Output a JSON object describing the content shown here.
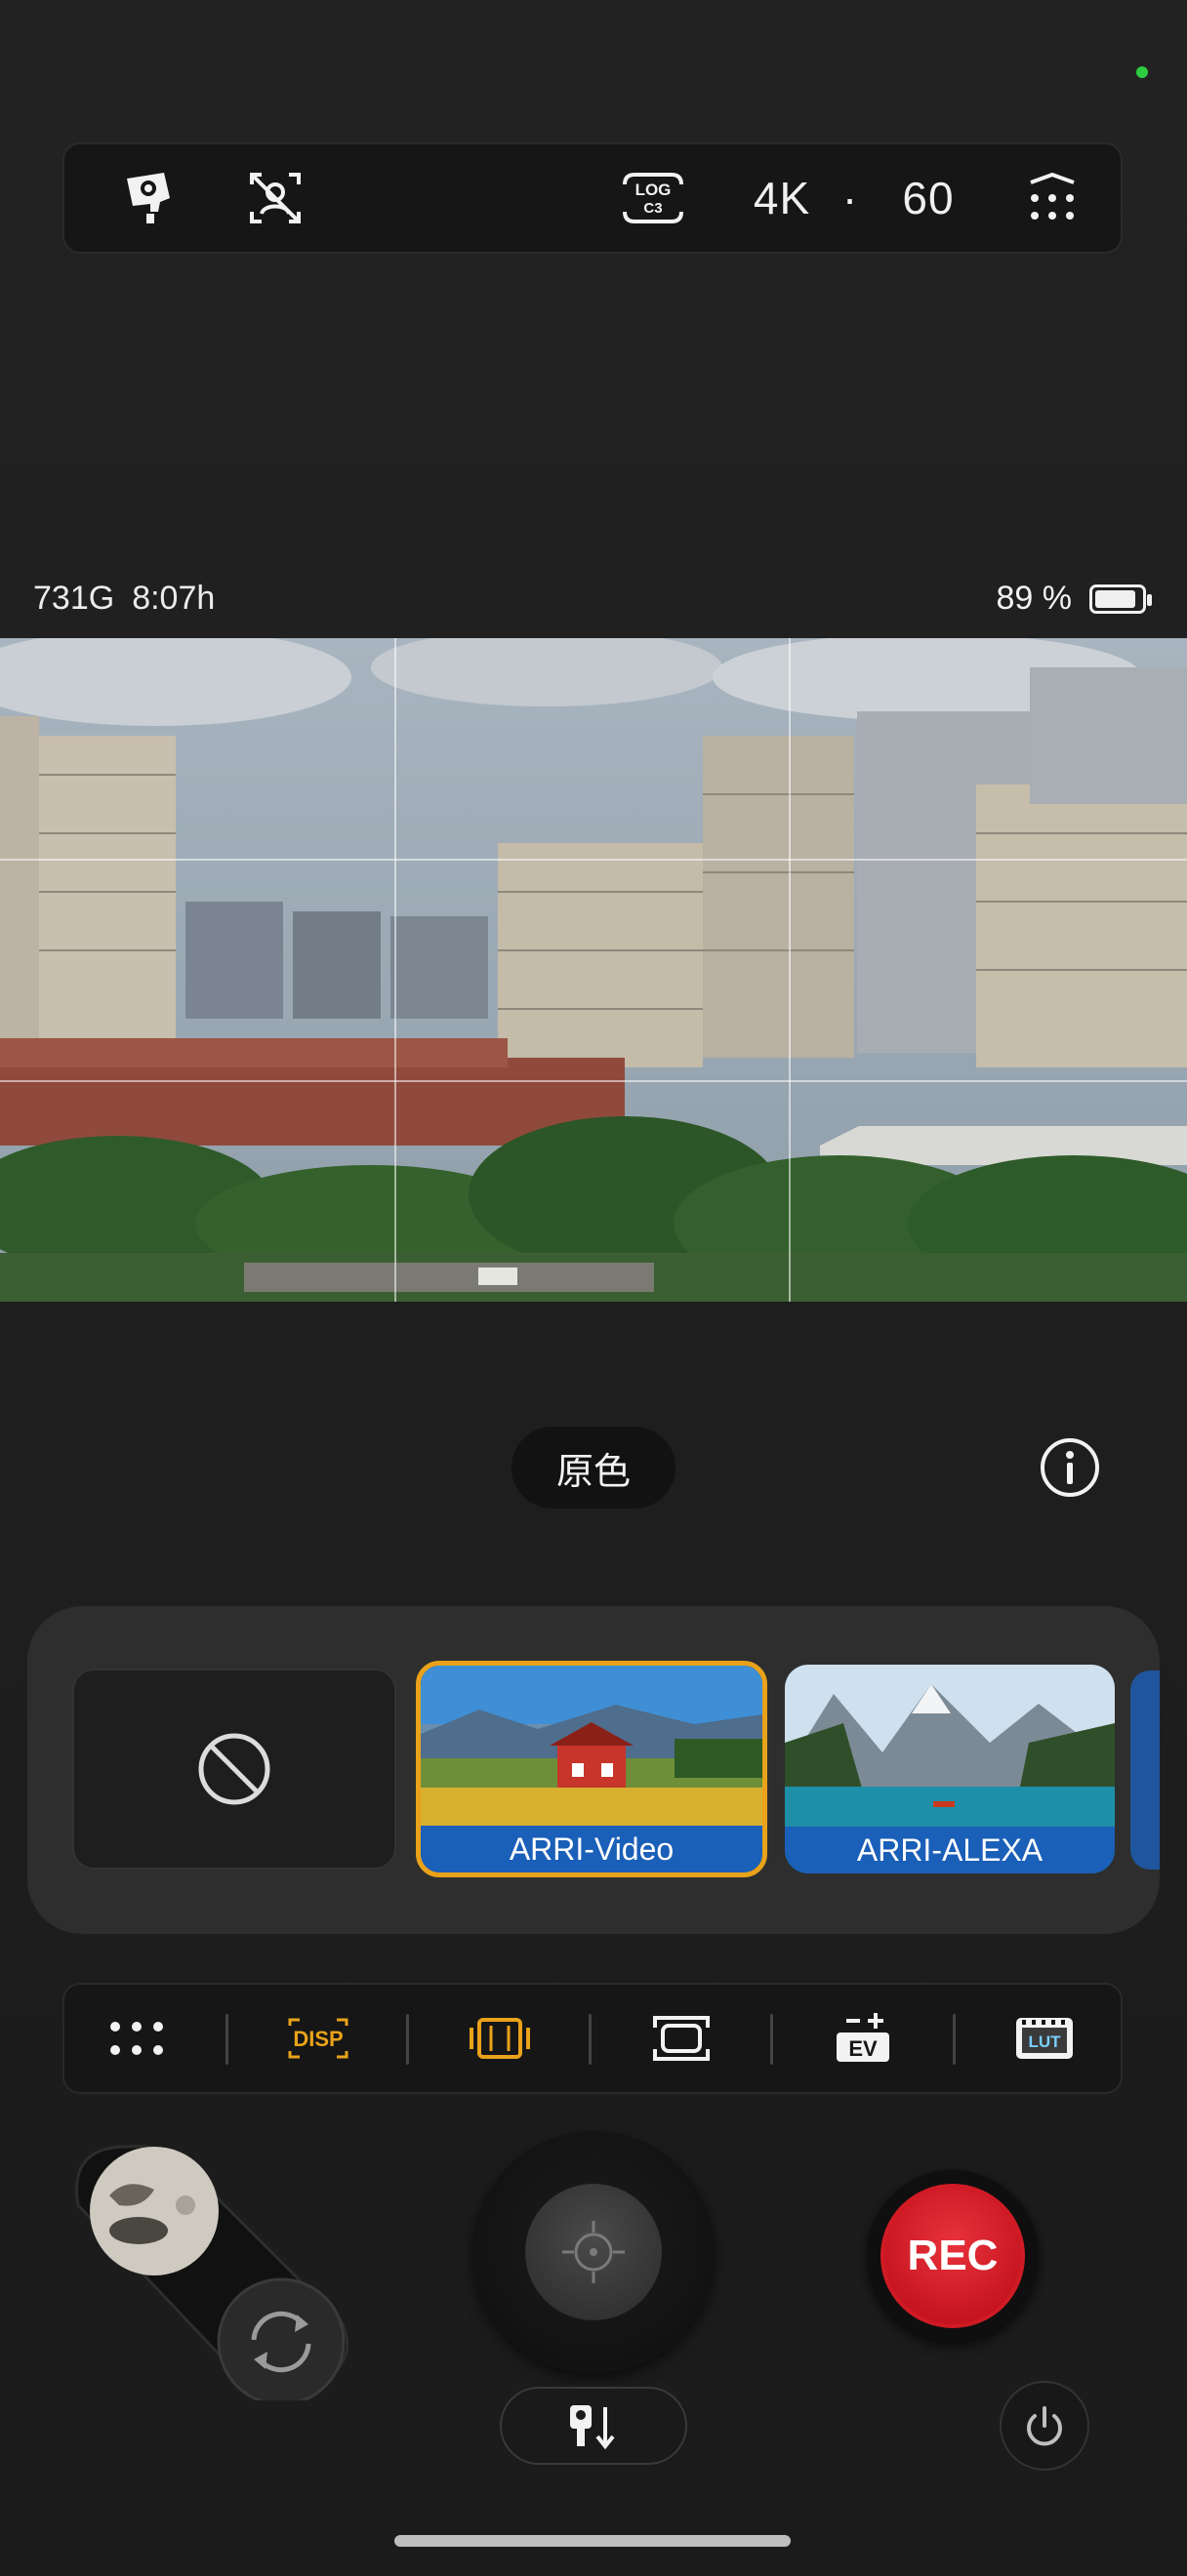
{
  "top_bar": {
    "log_badge_line1": "LOG",
    "log_badge_line2": "C3",
    "resolution": "4K",
    "separator": "·",
    "frame_rate": "60"
  },
  "status": {
    "storage": "731G",
    "time_remaining": "8:07h",
    "battery": "89 %",
    "battery_level": 0.89
  },
  "filter": {
    "current_name": "原色"
  },
  "lut_panel": {
    "items": [
      {
        "label": "",
        "icon": "none-icon"
      },
      {
        "label": "ARRI-Video",
        "selected": true
      },
      {
        "label": "ARRI-ALEXA",
        "selected": false
      }
    ]
  },
  "func_bar": {
    "items": [
      {
        "icon": "more-grid-icon"
      },
      {
        "icon": "disp-icon",
        "label": "DISP"
      },
      {
        "icon": "film-frame-icon"
      },
      {
        "icon": "frame-guide-icon"
      },
      {
        "icon": "ev-icon",
        "label": "EV"
      },
      {
        "icon": "lut-icon",
        "label": "LUT"
      }
    ]
  },
  "controls": {
    "rec_label": "REC"
  },
  "colors": {
    "accent": "#e9a21a",
    "rec": "#d01b25",
    "label_bar": "#1a5fb8",
    "status_dot": "#2ecc40"
  }
}
